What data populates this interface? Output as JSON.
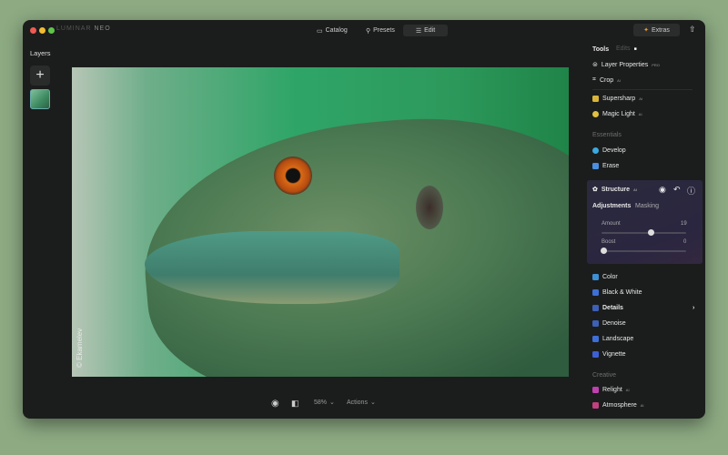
{
  "app": {
    "logo": "LUMINAR",
    "logo_suffix": "NEO"
  },
  "nav": {
    "catalog": "Catalog",
    "presets": "Presets",
    "edit": "Edit",
    "extras": "Extras"
  },
  "layers": {
    "title": "Layers"
  },
  "photo": {
    "credit": "© Ekamelev"
  },
  "bottom": {
    "zoom": "58%",
    "actions": "Actions"
  },
  "panel": {
    "tabs": {
      "tools": "Tools",
      "edits": "Edits"
    },
    "tools": [
      {
        "label": "Layer Properties",
        "badge": "PRO"
      },
      {
        "label": "Crop",
        "badge": "AI"
      }
    ],
    "ai_tools": [
      {
        "label": "Supersharp",
        "badge": "AI"
      },
      {
        "label": "Magic Light",
        "badge": "AI"
      }
    ],
    "essentials_title": "Essentials",
    "essentials": [
      {
        "label": "Develop"
      },
      {
        "label": "Erase"
      }
    ],
    "structure": {
      "label": "Structure",
      "badge": "AI",
      "tab_adjust": "Adjustments",
      "tab_mask": "Masking",
      "amount_label": "Amount",
      "amount_value": "19",
      "amount_fraction": 0.59,
      "boost_label": "Boost",
      "boost_value": "0",
      "boost_fraction": 0
    },
    "more": [
      {
        "label": "Color",
        "color": "#3d8fd6"
      },
      {
        "label": "Black & White",
        "color": "#3d6fd6"
      },
      {
        "label": "Details",
        "color": "#3d5fb6"
      },
      {
        "label": "Denoise",
        "color": "#3d5fb6"
      },
      {
        "label": "Landscape",
        "color": "#3d6fd6"
      },
      {
        "label": "Vignette",
        "color": "#3d5fd6"
      }
    ],
    "creative_title": "Creative",
    "creative": [
      {
        "label": "Relight",
        "badge": "AI",
        "color": "#c040b0"
      },
      {
        "label": "Atmosphere",
        "badge": "AI",
        "color": "#c04080"
      }
    ]
  }
}
